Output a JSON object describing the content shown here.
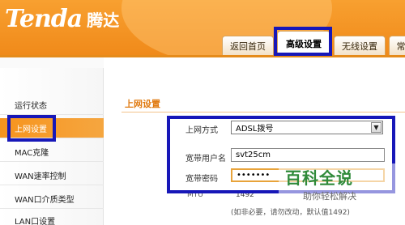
{
  "brand": {
    "logo_en": "Tenda",
    "logo_cn": "腾达"
  },
  "tabs": [
    {
      "label": "返回首页",
      "active": false
    },
    {
      "label": "高级设置",
      "active": true
    },
    {
      "label": "无线设置",
      "active": false
    },
    {
      "label": "常",
      "active": false
    }
  ],
  "sidebar": {
    "items": [
      {
        "label": "运行状态",
        "active": false
      },
      {
        "label": "上网设置",
        "active": true
      },
      {
        "label": "MAC克隆",
        "active": false
      },
      {
        "label": "WAN速率控制",
        "active": false
      },
      {
        "label": "WAN口介质类型",
        "active": false
      },
      {
        "label": "LAN口设置",
        "active": false
      }
    ]
  },
  "main": {
    "section_title": "上网设置",
    "form": {
      "mode_label": "上网方式",
      "mode_value": "ADSL拨号",
      "username_label": "宽带用户名",
      "username_value": "svt25cm",
      "password_label": "宽带密码",
      "password_value": "•••••••",
      "mtu_label": "MTU",
      "mtu_value": "1492",
      "hint": "(如非必要，请勿改动，默认值1492)"
    }
  },
  "watermark": {
    "main": "百科全说",
    "sub": "助你轻松解决"
  },
  "colors": {
    "accent_orange": "#f7941d",
    "highlight_blue": "#1717b8",
    "watermark_green": "#2f8a3a"
  }
}
